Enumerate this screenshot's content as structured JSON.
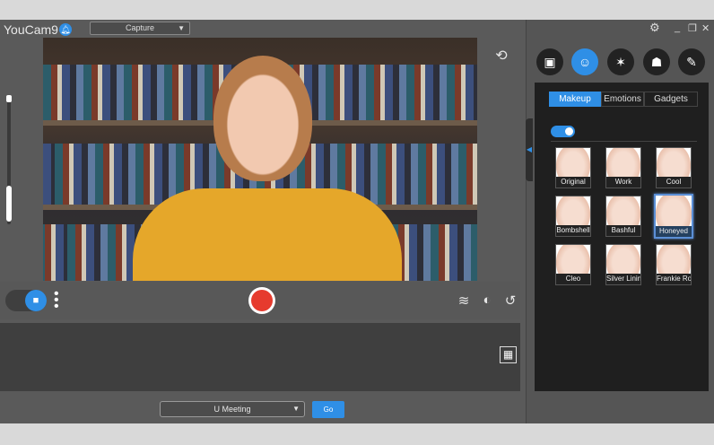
{
  "app": {
    "title": "YouCam9",
    "mode_select": "Capture",
    "accent": "#2f8fe6"
  },
  "window_controls": {
    "settings": "gear-icon",
    "minimize": "_",
    "restore": "❐",
    "close": "✕"
  },
  "feature_icons": [
    {
      "name": "frame-heart",
      "active": false
    },
    {
      "name": "face-beauty",
      "active": true
    },
    {
      "name": "particles",
      "active": false
    },
    {
      "name": "avatar",
      "active": false
    },
    {
      "name": "draw",
      "active": false
    }
  ],
  "tabs": [
    {
      "label": "Makeup",
      "active": true
    },
    {
      "label": "Emotions",
      "active": false
    },
    {
      "label": "Gadgets",
      "active": false
    }
  ],
  "makeup_enabled": true,
  "makeup_styles": [
    {
      "label": "Original",
      "selected": false
    },
    {
      "label": "Work",
      "selected": false
    },
    {
      "label": "Cool",
      "selected": false
    },
    {
      "label": "Bombshell",
      "selected": false
    },
    {
      "label": "Bashful",
      "selected": false
    },
    {
      "label": "Honeyed",
      "selected": true
    },
    {
      "label": "Cleo",
      "selected": false
    },
    {
      "label": "Silver Lining",
      "selected": false
    },
    {
      "label": "Frankie Roc",
      "selected": false
    }
  ],
  "bottom": {
    "meeting_select": "U Meeting",
    "go_label": "Go"
  },
  "controls": {
    "record_color": "#e63b2e"
  }
}
